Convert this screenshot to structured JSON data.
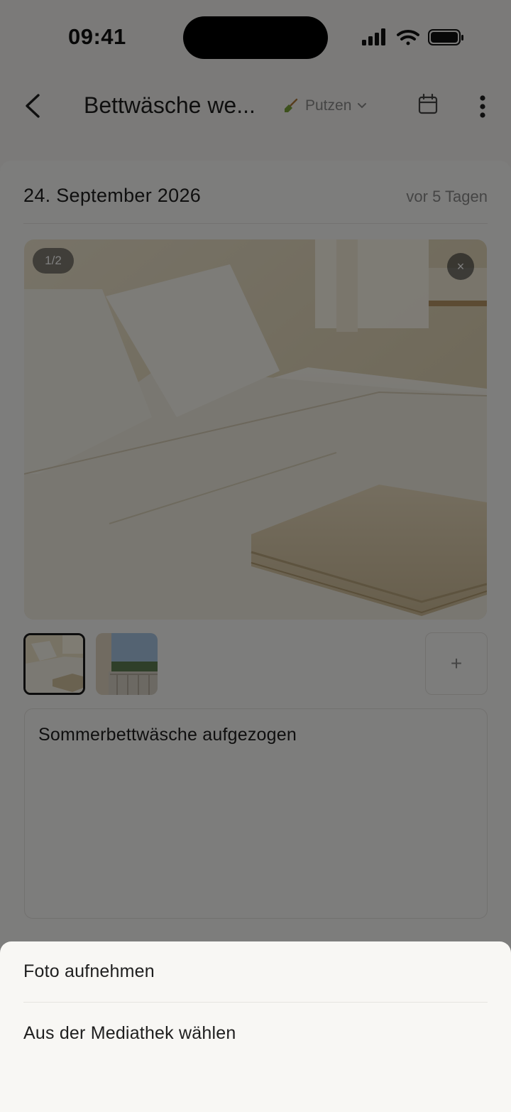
{
  "status_bar": {
    "time": "09:41"
  },
  "header": {
    "title": "Bettwäsche we...",
    "category": "Putzen",
    "category_icon": "broom-icon",
    "back_icon": "chevron-left-icon",
    "calendar_icon": "calendar-icon",
    "more_icon": "more-vertical-icon"
  },
  "entry": {
    "date": "24. September 2026",
    "relative_time": "vor 5 Tagen",
    "photo_counter": "1/2",
    "close_label": "×",
    "add_photo_label": "+",
    "note": "Sommerbettwäsche aufgezogen"
  },
  "action_sheet": {
    "items": [
      {
        "label": "Foto aufnehmen"
      },
      {
        "label": "Aus der Mediathek wählen"
      }
    ]
  },
  "colors": {
    "overlay": "#000000",
    "card_background": "#fbfaf8",
    "sheet_background": "#f8f7f4",
    "secondary_text": "#8a8a8a"
  }
}
